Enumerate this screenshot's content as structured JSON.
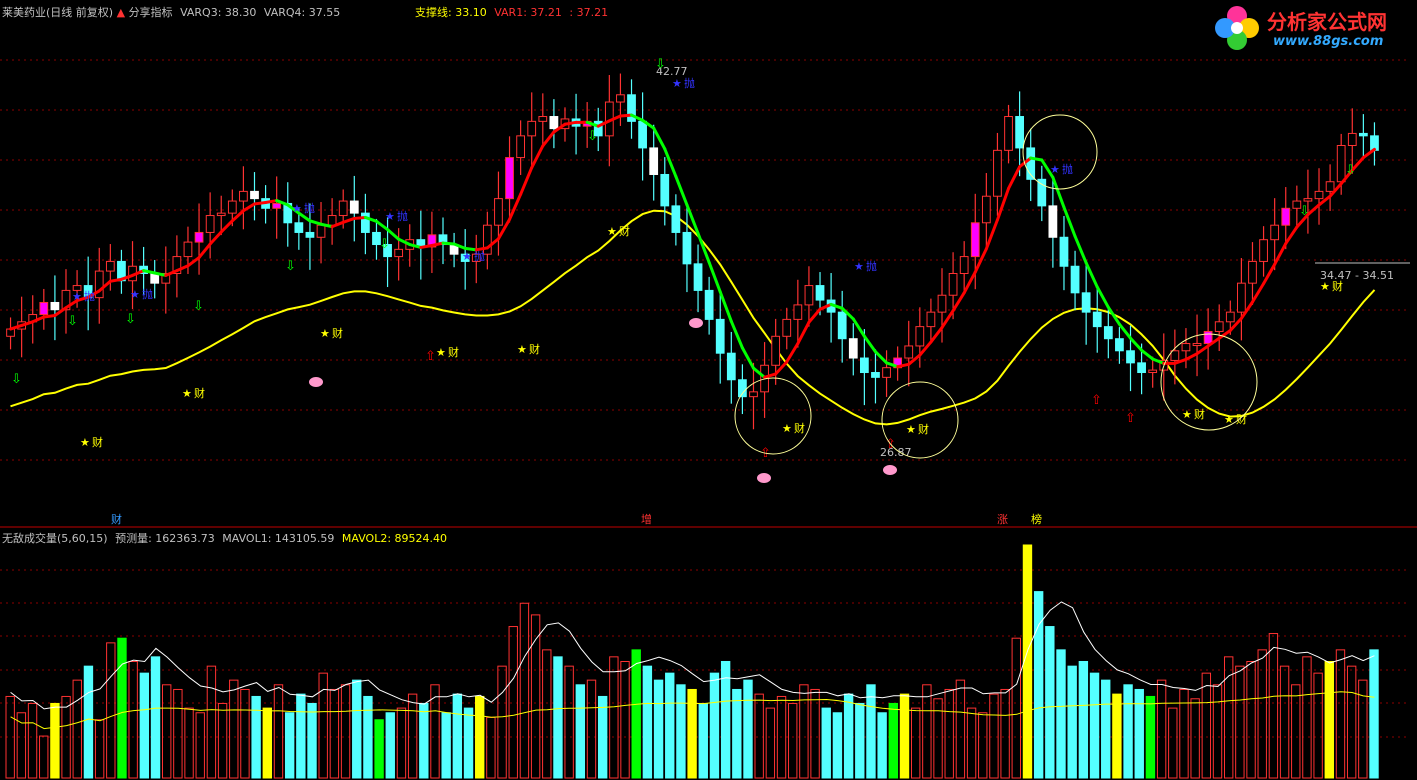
{
  "header": {
    "stock_title": "莱美药业(日线 前复权)",
    "share_label": "分享指标",
    "varq3": "VARQ3: 38.30",
    "varq4": "VARQ4: 37.55",
    "support": "支撑线: 33.10",
    "var1": "VAR1: 37.21",
    "var1b": ": 37.21"
  },
  "volume_header": {
    "title": "无敌成交量(5,60,15)",
    "forecast": "预测量: 162363.73",
    "mavol1": "MAVOL1: 143105.59",
    "mavol2": "MAVOL2: 89524.40"
  },
  "logo": {
    "name": "分析家公式网",
    "url": "www.88gs.com"
  },
  "annotations": {
    "high_label": "42.77",
    "low_label": "26.87",
    "range_label": "34.47 - 34.51",
    "signal_cai": "财",
    "signal_pao": "抛",
    "axis_marks": [
      "财",
      "增",
      "涨",
      "榜"
    ]
  },
  "colors": {
    "up": "#ff3232",
    "down": "#54ffff",
    "bull_fill": "#ff00ff",
    "flat": "#ffffff",
    "ma_red": "#ff0000",
    "ma_green": "#00ff00",
    "support": "#ffff00",
    "vol_yellow": "#ffff00",
    "vol_green": "#00ff00",
    "grid": "#8b0000"
  },
  "chart_data": {
    "type": "candlestick",
    "price_axis_visible": false,
    "high_marker": 42.77,
    "low_marker": 26.87,
    "closes": [
      32.2,
      32.5,
      32.8,
      33.3,
      33.0,
      33.8,
      34.0,
      33.5,
      34.6,
      35.0,
      34.2,
      34.8,
      34.5,
      34.1,
      34.5,
      35.2,
      35.8,
      36.2,
      36.9,
      37.0,
      37.5,
      37.9,
      37.6,
      37.2,
      37.4,
      36.6,
      36.2,
      36.0,
      36.5,
      36.9,
      37.5,
      37.0,
      36.2,
      35.7,
      35.2,
      35.5,
      35.9,
      35.6,
      36.1,
      35.7,
      35.3,
      35.0,
      35.3,
      36.5,
      37.6,
      39.3,
      40.2,
      40.8,
      41.0,
      40.5,
      40.9,
      40.6,
      40.8,
      40.2,
      41.6,
      41.9,
      40.8,
      39.7,
      38.6,
      37.3,
      36.2,
      34.9,
      33.8,
      32.6,
      31.2,
      30.1,
      29.4,
      29.6,
      30.7,
      31.9,
      32.6,
      33.2,
      34.0,
      33.4,
      32.9,
      31.8,
      31.0,
      30.4,
      30.2,
      30.6,
      31.0,
      31.5,
      32.3,
      32.9,
      33.6,
      34.5,
      35.2,
      36.6,
      37.7,
      39.6,
      41.0,
      39.7,
      38.4,
      37.3,
      36.0,
      34.8,
      33.7,
      32.9,
      32.3,
      31.8,
      31.3,
      30.8,
      30.4,
      30.5,
      30.9,
      31.3,
      31.6,
      31.6,
      32.1,
      32.5,
      32.9,
      34.1,
      35.0,
      35.9,
      36.5,
      37.2,
      37.5,
      37.6,
      37.9,
      38.3,
      39.8,
      40.3,
      40.2,
      39.6
    ]
  },
  "volume_data": {
    "mavol1": 143105.59,
    "mavol2": 89524.4,
    "bars": [
      35,
      28,
      32,
      18,
      32,
      35,
      42,
      48,
      25,
      58,
      60,
      50,
      45,
      52,
      40,
      38,
      30,
      28,
      48,
      32,
      42,
      38,
      35,
      30,
      40,
      28,
      36,
      32,
      45,
      38,
      40,
      42,
      35,
      25,
      28,
      30,
      36,
      32,
      40,
      28,
      36,
      30,
      35,
      26,
      48,
      65,
      75,
      70,
      55,
      52,
      48,
      40,
      42,
      35,
      52,
      50,
      55,
      48,
      42,
      45,
      40,
      38,
      32,
      45,
      50,
      38,
      42,
      36,
      30,
      35,
      32,
      40,
      38,
      30,
      28,
      36,
      32,
      40,
      28,
      32,
      36,
      30,
      40,
      34,
      38,
      42,
      30,
      28,
      36,
      38,
      60,
      100,
      80,
      65,
      55,
      48,
      50,
      45,
      42,
      36,
      40,
      38,
      35,
      42,
      30,
      38,
      34,
      45,
      40,
      52,
      48,
      50,
      55,
      62,
      48,
      40,
      52,
      45,
      50,
      55,
      48,
      42,
      55
    ]
  }
}
